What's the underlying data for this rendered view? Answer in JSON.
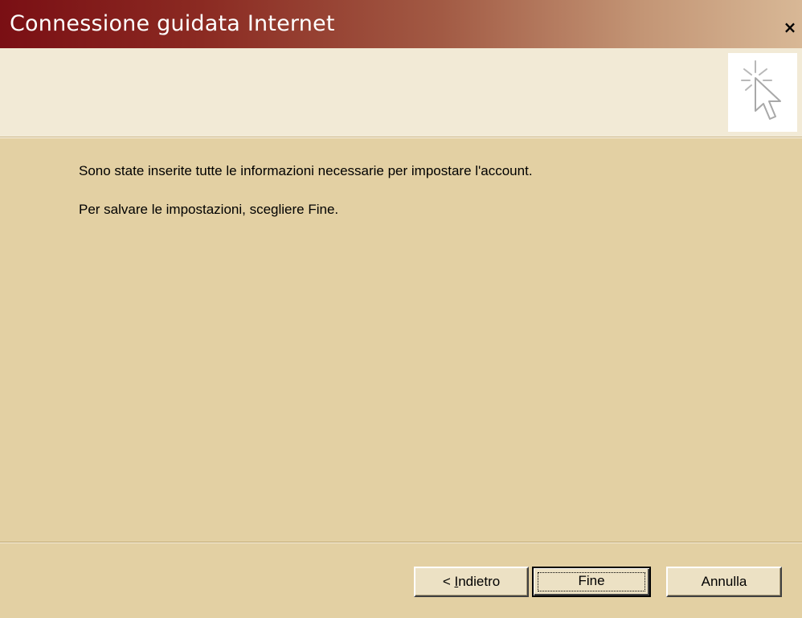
{
  "window": {
    "title": "Connessione guidata Internet",
    "close_label": "×"
  },
  "content": {
    "line1": "Sono state inserite tutte le informazioni necessarie per impostare l'account.",
    "line2": "Per salvare le impostazioni, scegliere Fine."
  },
  "buttons": {
    "back_prefix": "< ",
    "back_accel": "I",
    "back_rest": "ndietro",
    "finish": "Fine",
    "cancel": "Annulla"
  },
  "icons": {
    "wizard": "wizard-cursor-sparkle-icon",
    "close": "close-icon"
  },
  "colors": {
    "title_start": "#7a0f14",
    "title_end": "#d8b896",
    "dialog_bg": "#e3d0a3",
    "banner_bg": "#f2ead6"
  }
}
